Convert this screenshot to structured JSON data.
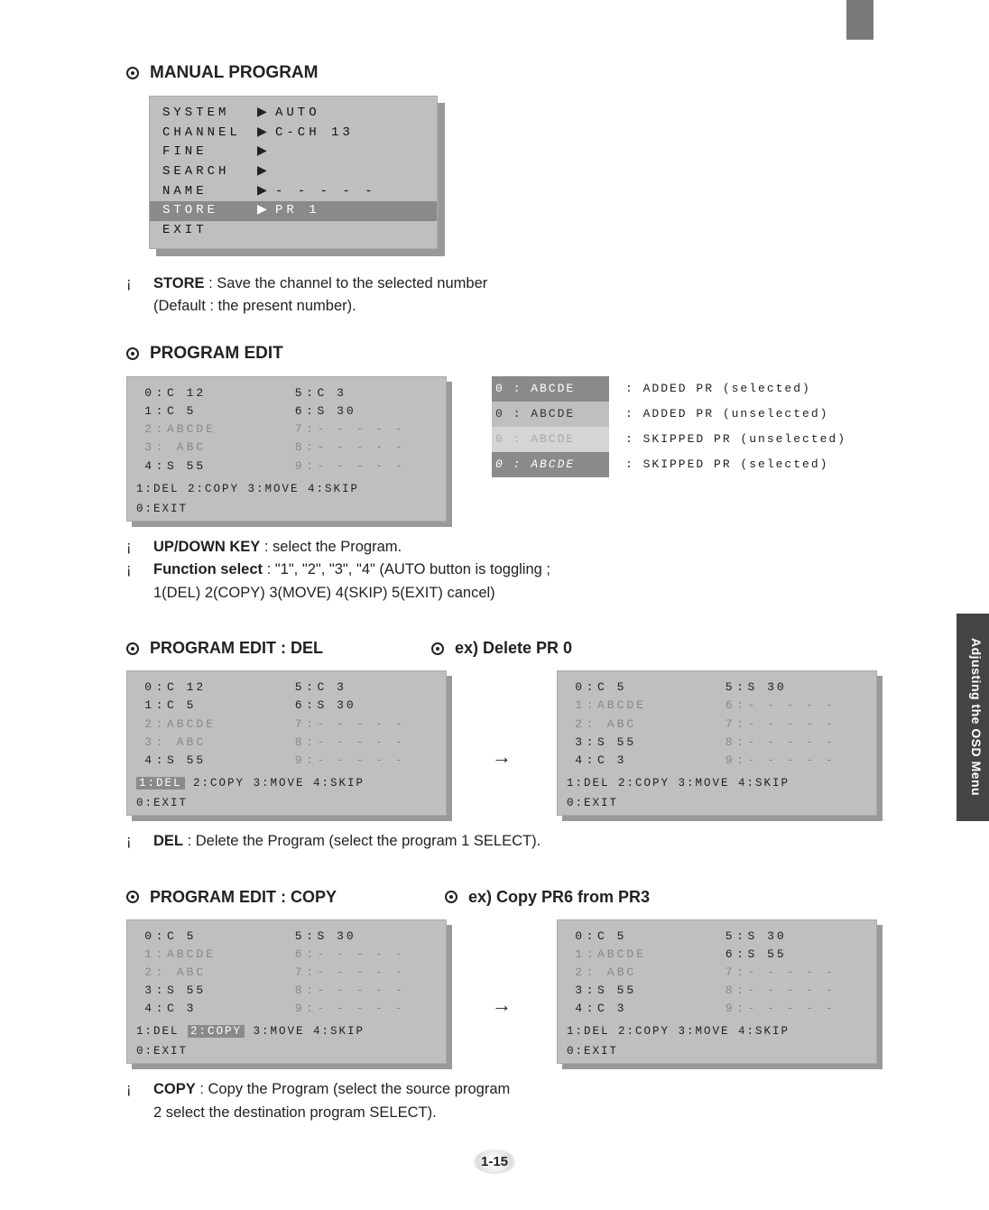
{
  "side_tab": "Adjusting the OSD Menu",
  "page_number": "1-15",
  "sections": {
    "manual_program": {
      "title": "MANUAL PROGRAM",
      "menu": {
        "rows": [
          {
            "lbl": "SYSTEM",
            "arr": "▶",
            "val": "AUTO"
          },
          {
            "lbl": "CHANNEL",
            "arr": "▶",
            "val": "C-CH  13"
          },
          {
            "lbl": "FINE",
            "arr": "▶",
            "val": ""
          },
          {
            "lbl": "SEARCH",
            "arr": "▶",
            "val": ""
          },
          {
            "lbl": "NAME",
            "arr": "▶",
            "val": "- - - - -"
          },
          {
            "lbl": "STORE",
            "arr": "▶",
            "val": "PR    1",
            "sel": true
          },
          {
            "lbl": "EXIT",
            "arr": "",
            "val": ""
          }
        ]
      },
      "note_strong": "STORE",
      "note_rest": " : Save the channel to the selected number",
      "note_line2": "(Default : the present number)."
    },
    "program_edit": {
      "title": "PROGRAM EDIT",
      "grid": {
        "left": [
          {
            "n": "0",
            "t": "C  12",
            "hl": true
          },
          {
            "n": "1",
            "t": "C   5"
          },
          {
            "n": "2",
            "t": "ABCDE",
            "dim": true
          },
          {
            "n": "3",
            "t": "  ABC",
            "dim": true
          },
          {
            "n": "4",
            "t": "S  55"
          }
        ],
        "right": [
          {
            "n": "5",
            "t": "C   3"
          },
          {
            "n": "6",
            "t": "S  30"
          },
          {
            "n": "7",
            "t": "- - - - -",
            "dim": true
          },
          {
            "n": "8",
            "t": "- - - - -",
            "dim": true
          },
          {
            "n": "9",
            "t": "- - - - -",
            "dim": true
          }
        ],
        "cmd": "1:DEL  2:COPY  3:MOVE  4:SKIP",
        "cmd2": "0:EXIT"
      },
      "legend": [
        {
          "badge": "0  :  ABCDE",
          "style": "dark",
          "desc": ": ADDED PR (selected)"
        },
        {
          "badge": "0  :  ABCDE",
          "style": "light",
          "desc": ": ADDED PR (unselected)"
        },
        {
          "badge": "0  :  ABCDE",
          "style": "lighter",
          "desc": ": SKIPPED PR (unselected)"
        },
        {
          "badge": "0  :  ABCDE",
          "style": "dark it",
          "desc": ": SKIPPED PR (selected)"
        }
      ],
      "notes": [
        {
          "strong": "UP/DOWN KEY",
          "rest": " : select the Program."
        },
        {
          "strong": "Function select",
          "rest": " : \"1\", \"2\", \"3\", \"4\" (AUTO button is toggling ;"
        }
      ],
      "note_line3": "1(DEL)      2(COPY)      3(MOVE)      4(SKIP)      5(EXIT)       cancel)"
    },
    "del": {
      "title_left": "PROGRAM EDIT : DEL",
      "title_right": "ex) Delete PR 0",
      "before": {
        "left": [
          {
            "n": "0",
            "t": "C  12",
            "hl": true
          },
          {
            "n": "1",
            "t": "C   5"
          },
          {
            "n": "2",
            "t": "ABCDE",
            "dim": true
          },
          {
            "n": "3",
            "t": "  ABC",
            "dim": true
          },
          {
            "n": "4",
            "t": "S  55"
          }
        ],
        "right": [
          {
            "n": "5",
            "t": "C   3"
          },
          {
            "n": "6",
            "t": "S  30"
          },
          {
            "n": "7",
            "t": "- - - - -",
            "dim": true
          },
          {
            "n": "8",
            "t": "- - - - -",
            "dim": true
          },
          {
            "n": "9",
            "t": "- - - - -",
            "dim": true
          }
        ],
        "cmd_hl": "1:DEL",
        "cmd_rest": "  2:COPY  3:MOVE  4:SKIP",
        "cmd2": "0:EXIT"
      },
      "after": {
        "left": [
          {
            "n": "0",
            "t": "C   5",
            "hl": true
          },
          {
            "n": "1",
            "t": "ABCDE",
            "dim": true
          },
          {
            "n": "2",
            "t": "  ABC",
            "dim": true
          },
          {
            "n": "3",
            "t": "S  55"
          },
          {
            "n": "4",
            "t": "C   3"
          }
        ],
        "right": [
          {
            "n": "5",
            "t": "S  30"
          },
          {
            "n": "6",
            "t": "- - - - -",
            "dim": true
          },
          {
            "n": "7",
            "t": "- - - - -",
            "dim": true
          },
          {
            "n": "8",
            "t": "- - - - -",
            "dim": true
          },
          {
            "n": "9",
            "t": "- - - - -",
            "dim": true
          }
        ],
        "cmd": "1:DEL  2:COPY  3:MOVE  4:SKIP",
        "cmd2": "0:EXIT"
      },
      "note_strong": "DEL",
      "note_rest": " : Delete the Program (select the program      1      SELECT)."
    },
    "copy": {
      "title_left": "PROGRAM EDIT : COPY",
      "title_right": "ex) Copy PR6 from PR3",
      "before": {
        "left": [
          {
            "n": "0",
            "t": "C   5"
          },
          {
            "n": "1",
            "t": "ABCDE",
            "dim": true
          },
          {
            "n": "2",
            "t": "  ABC",
            "dim": true
          },
          {
            "n": "3",
            "t": "S  55",
            "hl": true
          },
          {
            "n": "4",
            "t": "C   3"
          }
        ],
        "right": [
          {
            "n": "5",
            "t": "S  30"
          },
          {
            "n": "6",
            "t": "- - - - -",
            "dim": true
          },
          {
            "n": "7",
            "t": "- - - - -",
            "dim": true
          },
          {
            "n": "8",
            "t": "- - - - -",
            "dim": true
          },
          {
            "n": "9",
            "t": "- - - - -",
            "dim": true
          }
        ],
        "cmd_pre": "1:DEL  ",
        "cmd_hl": "2:COPY",
        "cmd_rest": "  3:MOVE  4:SKIP",
        "cmd2": "0:EXIT"
      },
      "after": {
        "left": [
          {
            "n": "0",
            "t": "C   5"
          },
          {
            "n": "1",
            "t": "ABCDE",
            "dim": true
          },
          {
            "n": "2",
            "t": "  ABC",
            "dim": true
          },
          {
            "n": "3",
            "t": "S  55"
          },
          {
            "n": "4",
            "t": "C   3"
          }
        ],
        "right": [
          {
            "n": "5",
            "t": "S  30"
          },
          {
            "n": "6",
            "t": "S  55",
            "hl": true
          },
          {
            "n": "7",
            "t": "- - - - -",
            "dim": true
          },
          {
            "n": "8",
            "t": "- - - - -",
            "dim": true
          },
          {
            "n": "9",
            "t": "- - - - -",
            "dim": true
          }
        ],
        "cmd": "1:DEL  2:COPY  3:MOVE  4:SKIP",
        "cmd2": "0:EXIT"
      },
      "note_strong": "COPY",
      "note_rest": " : Copy the Program (select the source program",
      "note_line2": "2      select the destination program      SELECT)."
    }
  }
}
